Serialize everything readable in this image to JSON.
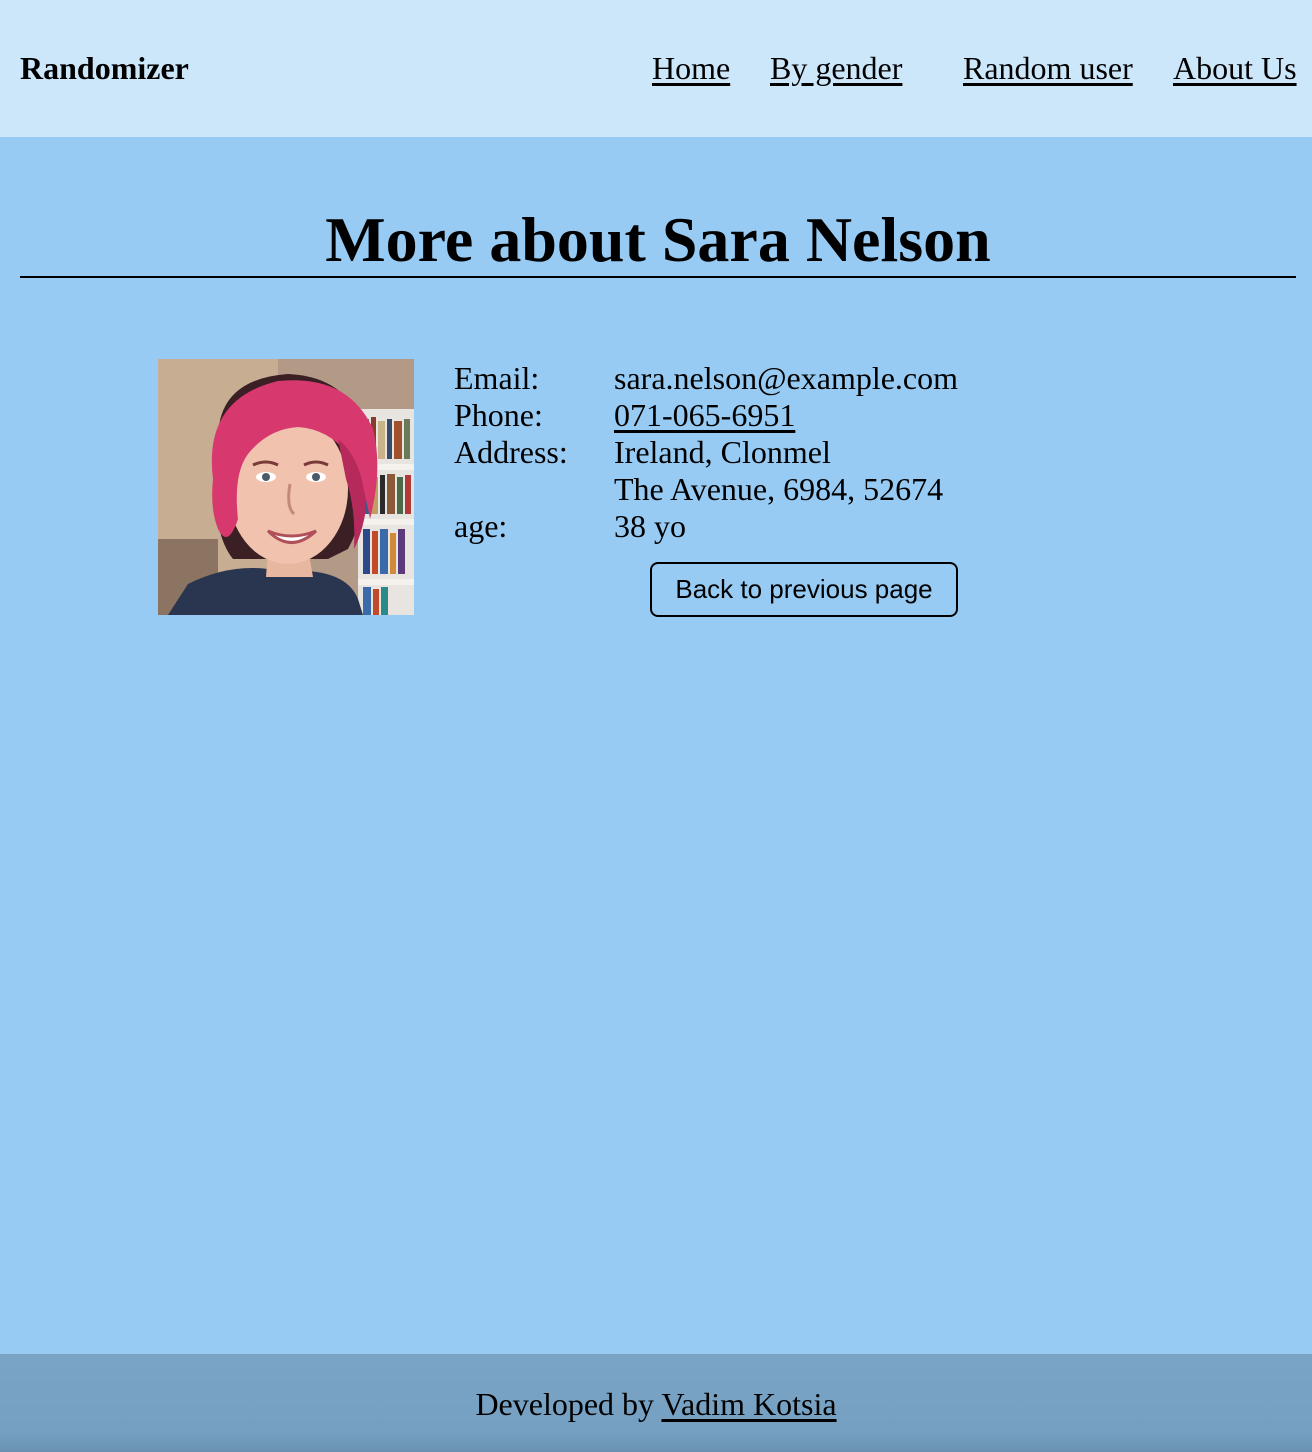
{
  "header": {
    "brand": "Randomizer",
    "nav": [
      {
        "label": "Home"
      },
      {
        "label": "By gender"
      },
      {
        "label": "Random user"
      },
      {
        "label": "About Us"
      }
    ]
  },
  "main": {
    "title": "More about Sara Nelson",
    "details": {
      "email_label": "Email:",
      "email_value": "sara.nelson@example.com",
      "phone_label": "Phone:",
      "phone_value": "071-065-6951",
      "address_label": "Address:",
      "address_line1": "Ireland, Clonmel",
      "address_line2": "The Avenue, 6984, 52674",
      "age_label": "age:",
      "age_value": "38 yo"
    },
    "back_button_label": "Back to previous page",
    "avatar_icon": "user-photo-icon"
  },
  "footer": {
    "prefix": "Developed by",
    "author": "Vadim Kotsia"
  },
  "colors": {
    "header_bg": "#cce6fa",
    "body_bg": "#97cbf4",
    "footer_bg": "#7aa4c6"
  }
}
